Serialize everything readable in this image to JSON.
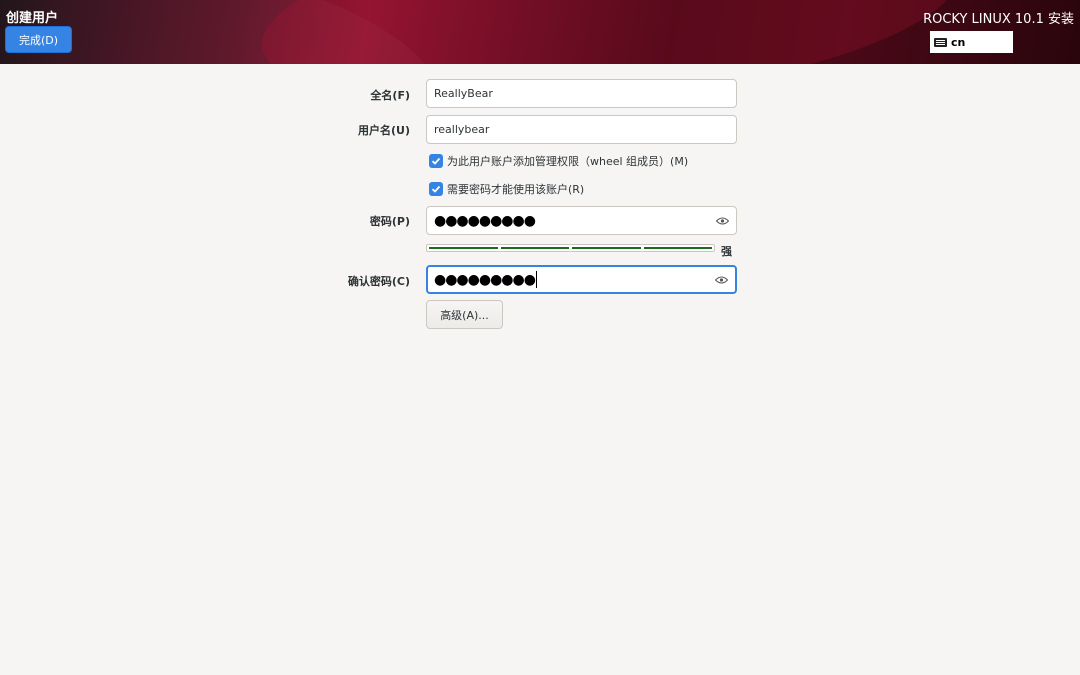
{
  "header": {
    "title": "创建用户",
    "done_label": "完成(D)",
    "product_title": "ROCKY LINUX 10.1 安装",
    "keyboard_layout": "cn"
  },
  "form": {
    "fullname": {
      "label": "全名(F)",
      "value": "ReallyBear"
    },
    "username": {
      "label": "用户名(U)",
      "value": "reallybear"
    },
    "admin_check": {
      "label": "为此用户账户添加管理权限（wheel 组成员）(M)",
      "checked": true
    },
    "require_password_check": {
      "label": "需要密码才能使用该账户(R)",
      "checked": true
    },
    "password": {
      "label": "密码(P)",
      "masked": "●●●●●●●●●"
    },
    "strength": {
      "label": "强",
      "level": 4,
      "max": 4
    },
    "confirm": {
      "label": "确认密码(C)",
      "masked": "●●●●●●●●●"
    },
    "advanced_label": "高级(A)..."
  },
  "colors": {
    "accent": "#3584e4",
    "strength_fill": "#1c6b1c"
  }
}
